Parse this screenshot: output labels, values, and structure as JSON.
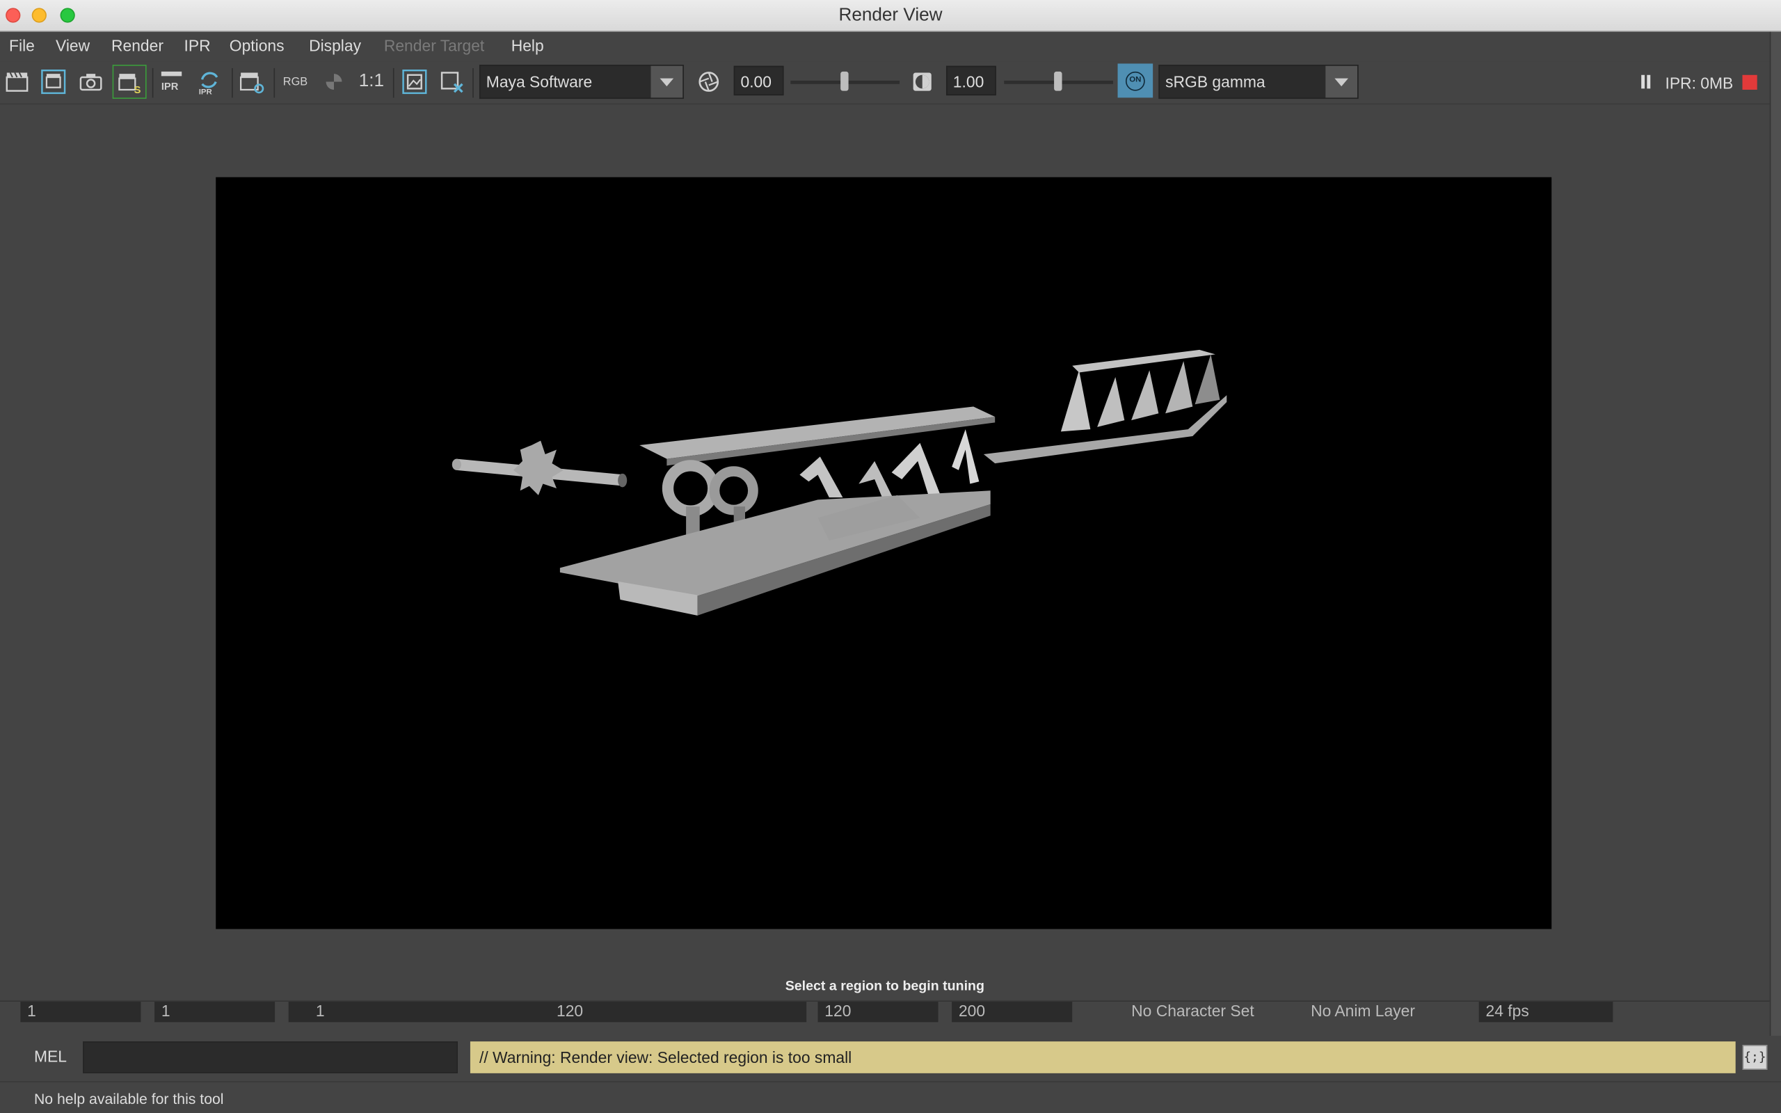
{
  "window": {
    "title": "Render View"
  },
  "menu": [
    "File",
    "View",
    "Render",
    "IPR",
    "Options",
    "Display",
    "Render Target",
    "Help"
  ],
  "toolbar": {
    "rgb_label": "RGB",
    "ratio_label": "1:1",
    "renderer": "Maya Software",
    "exposure": "0.00",
    "exposure_level": 0.5,
    "gamma": "1.00",
    "gamma_level": 0.5,
    "color_management_on": "ON",
    "view_transform": "sRGB gamma",
    "ipr_status": "IPR: 0MB"
  },
  "viewport": {
    "hint": "Select a region to begin tuning"
  },
  "time_row": {
    "start_field": "1",
    "current_field": "1",
    "range_start": "1",
    "range_end": "120",
    "end_field": "120",
    "anim_end": "200",
    "character_set": "No Character Set",
    "anim_layer": "No Anim Layer",
    "fps": "24 fps"
  },
  "command": {
    "mel_label": "MEL",
    "warning": "// Warning: Render view: Selected region is too small",
    "script_editor_icon": "{;}"
  },
  "help_line": "No help available for this tool",
  "colors": {
    "accent": "#4f8fb3",
    "warning_bg": "#d7c98a",
    "stop": "#e23a3a"
  }
}
